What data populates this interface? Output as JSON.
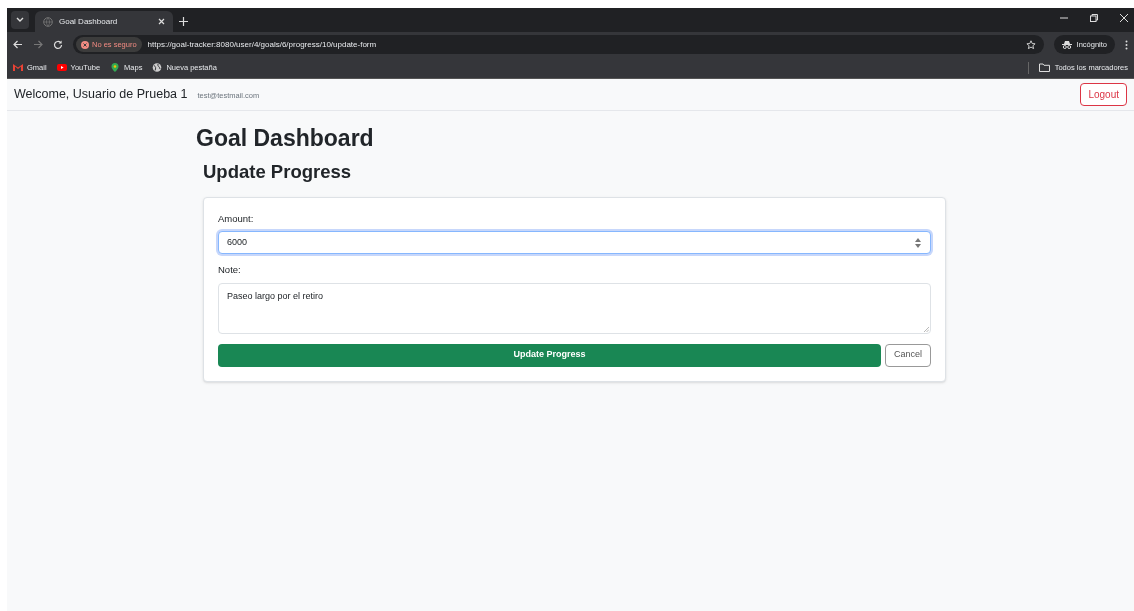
{
  "browser": {
    "tabs": [
      {
        "title": "Goal Dashboard",
        "selected": true
      }
    ],
    "security_chip": "No es seguro",
    "url": "https://goal-tracker:8080/user/4/goals/6/progress/10/update-form",
    "profile": "Incógnito",
    "bookmarks": [
      {
        "label": "Gmail",
        "kind": "gmail"
      },
      {
        "label": "YouTube",
        "kind": "youtube"
      },
      {
        "label": "Maps",
        "kind": "maps"
      },
      {
        "label": "Nueva pestaña",
        "kind": "globe"
      }
    ],
    "all_bookmarks": "Todos los marcadores"
  },
  "navbar": {
    "welcome": "Welcome, Usuario de Prueba 1",
    "email": "test@testmail.com",
    "logout": "Logout"
  },
  "page": {
    "title": "Goal Dashboard",
    "subtitle": "Update Progress",
    "form": {
      "fields": [
        {
          "label": "Amount:",
          "kind": "number",
          "value": "6000",
          "focused": true
        },
        {
          "label": "Note:",
          "kind": "textarea",
          "value": "Paseo largo por el retiro",
          "focused": false
        }
      ],
      "submit": "Update Progress",
      "cancel": "Cancel"
    }
  }
}
